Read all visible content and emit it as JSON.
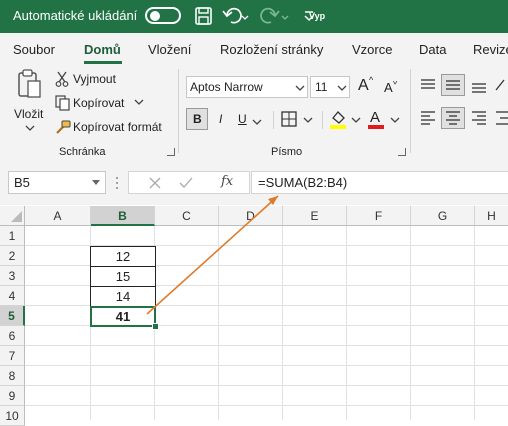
{
  "titlebar": {
    "autosave_label": "Automatické ukládání",
    "toggle_state": "Vyp"
  },
  "tabs": [
    "Soubor",
    "Domů",
    "Vložení",
    "Rozložení stránky",
    "Vzorce",
    "Data",
    "Revize"
  ],
  "active_tab": "Domů",
  "ribbon": {
    "clipboard": {
      "paste_label": "Vložit",
      "cut_label": "Vyjmout",
      "copy_label": "Kopírovat",
      "format_painter_label": "Kopírovat formát",
      "group_label": "Schránka"
    },
    "font": {
      "font_name": "Aptos Narrow",
      "font_size": "11",
      "bold_label": "B",
      "italic_label": "I",
      "underline_label": "U",
      "grow_label": "A",
      "shrink_label": "A",
      "font_color_label": "A",
      "group_label": "Písmo",
      "highlight_color": "#ffff00",
      "font_color": "#e01b1b"
    }
  },
  "formula_bar": {
    "name_box": "B5",
    "fx_label": "fx",
    "formula": "=SUMA(B2:B4)"
  },
  "grid": {
    "columns": [
      "A",
      "B",
      "C",
      "D",
      "E",
      "F",
      "G",
      "H"
    ],
    "rows": [
      "1",
      "2",
      "3",
      "4",
      "5",
      "6",
      "7",
      "8",
      "9",
      "10"
    ],
    "selected_column": "B",
    "selected_row": "5",
    "values": [
      {
        "cell": "B2",
        "value": "12"
      },
      {
        "cell": "B3",
        "value": "15"
      },
      {
        "cell": "B4",
        "value": "14"
      },
      {
        "cell": "B5",
        "value": "41"
      }
    ]
  },
  "colors": {
    "accent": "#217346",
    "arrow": "#e07b2a"
  }
}
